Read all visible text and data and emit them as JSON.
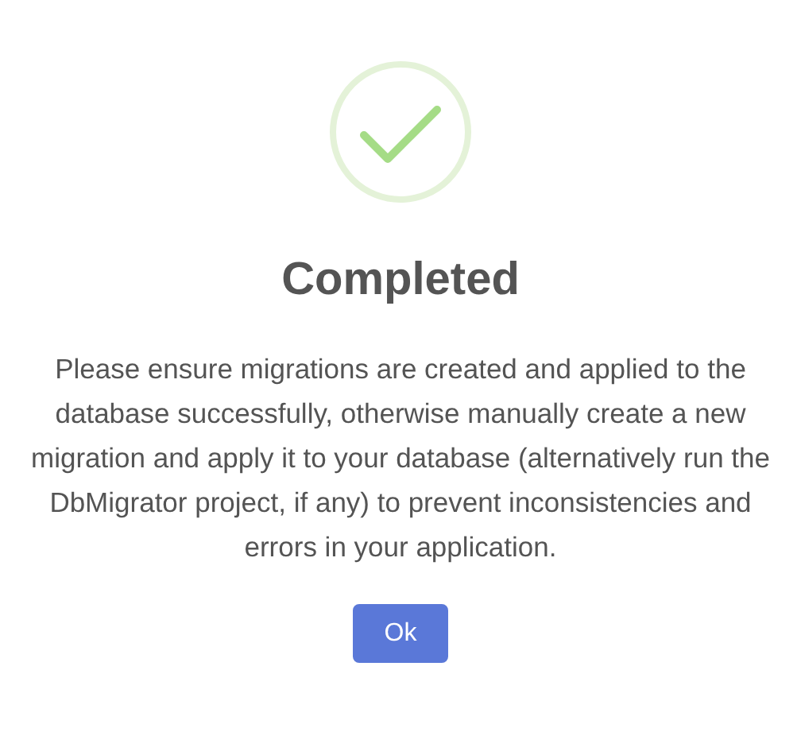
{
  "dialog": {
    "kind": "success",
    "title": "Completed",
    "message": "Please ensure migrations are created and applied to the database successfully, otherwise manually create a new migration and apply it to your database (alternatively run the DbMigrator project, if any) to prevent inconsistencies and errors in your application.",
    "buttons": [
      "Ok"
    ]
  }
}
